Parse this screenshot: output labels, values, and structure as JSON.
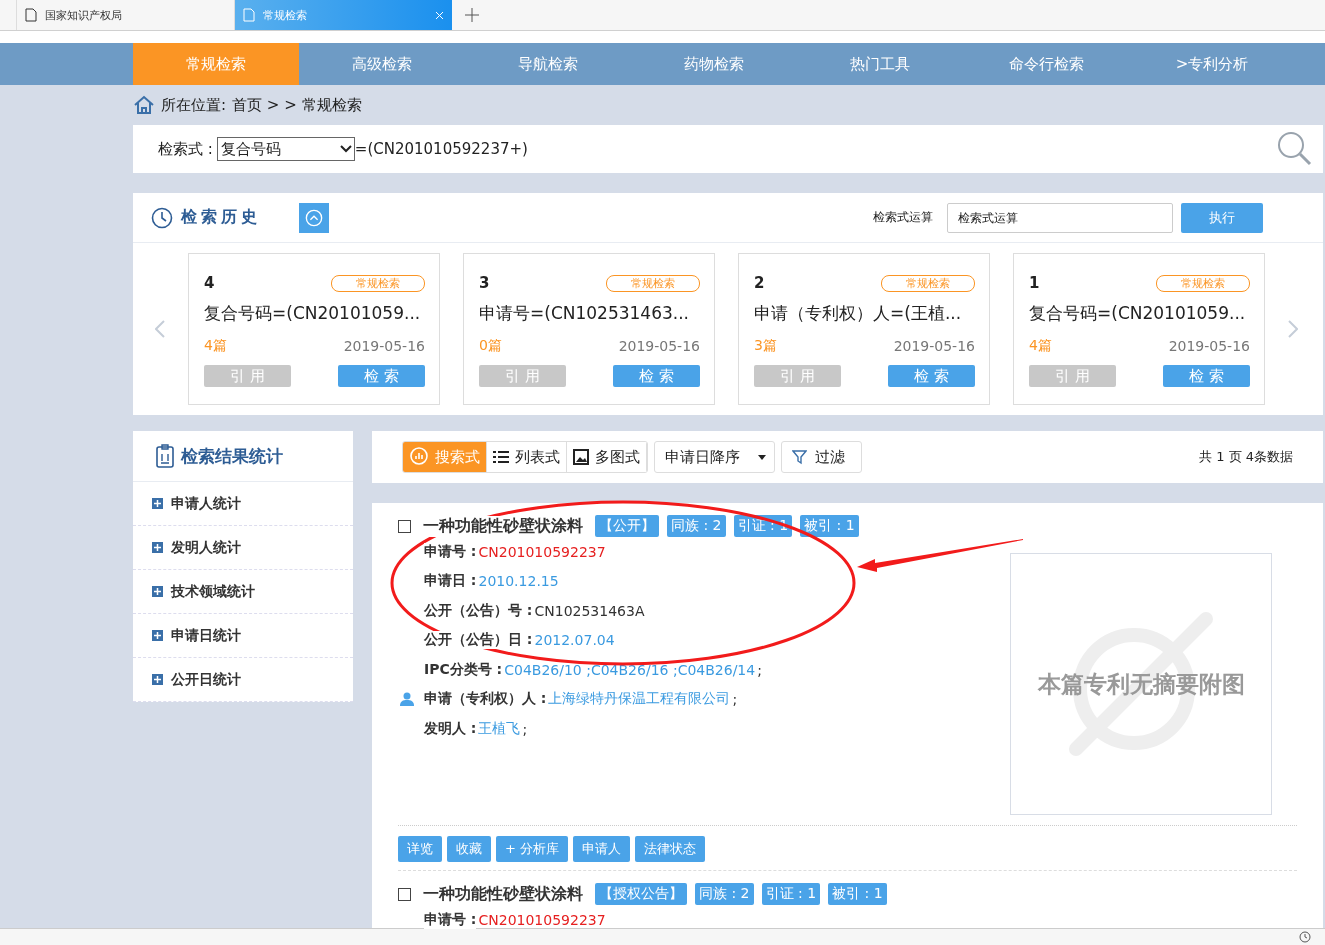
{
  "browser_tabs": [
    {
      "title": "国家知识产权局",
      "selected": false
    },
    {
      "title": "常规检索",
      "selected": true
    }
  ],
  "nav": [
    {
      "label": "常规检索",
      "selected": true
    },
    {
      "label": "高级检索",
      "selected": false
    },
    {
      "label": "导航检索",
      "selected": false
    },
    {
      "label": "药物检索",
      "selected": false
    },
    {
      "label": "热门工具",
      "selected": false
    },
    {
      "label": "命令行检索",
      "selected": false
    },
    {
      "label": ">专利分析",
      "selected": false
    }
  ],
  "breadcrumb": {
    "label": "所在位置:",
    "path": "首页 > > 常规检索"
  },
  "search": {
    "label": "检索式 :",
    "field_type": "复合号码",
    "value": "=(CN201010592237+)"
  },
  "history": {
    "title": "检索历史",
    "calc_label": "检索式运算",
    "calc_placeholder": "检索式运算",
    "run_button": "执行",
    "cards": [
      {
        "number": "4",
        "tag": "常规检索",
        "query": "复合号码=(CN20101059...",
        "count": "4篇",
        "date": "2019-05-16",
        "cite_button": "引 用",
        "search_button": "检 索"
      },
      {
        "number": "3",
        "tag": "常规检索",
        "query": "申请号=(CN102531463...",
        "count": "0篇",
        "date": "2019-05-16",
        "cite_button": "引 用",
        "search_button": "检 索"
      },
      {
        "number": "2",
        "tag": "常规检索",
        "query": "申请（专利权）人=(王植...",
        "count": "3篇",
        "date": "2019-05-16",
        "cite_button": "引 用",
        "search_button": "检 索"
      },
      {
        "number": "1",
        "tag": "常规检索",
        "query": "复合号码=(CN20101059...",
        "count": "4篇",
        "date": "2019-05-16",
        "cite_button": "引 用",
        "search_button": "检 索"
      }
    ]
  },
  "stats": {
    "title": "检索结果统计",
    "items": [
      "申请人统计",
      "发明人统计",
      "技术领域统计",
      "申请日统计",
      "公开日统计"
    ]
  },
  "toolbar": {
    "views": [
      {
        "label": "搜索式",
        "selected": true
      },
      {
        "label": "列表式",
        "selected": false
      },
      {
        "label": "多图式",
        "selected": false
      }
    ],
    "sort": "申请日降序",
    "filter": "过滤",
    "summary": "共 1 页 4条数据"
  },
  "results": [
    {
      "checked": false,
      "title": "一种功能性砂壁状涂料",
      "tags": [
        "【公开】",
        "同族 : 2",
        "引证 : 1",
        "被引 : 1"
      ],
      "fields": [
        {
          "kind": "number",
          "label": "申请号 :",
          "value": "CN201010592237"
        },
        {
          "kind": "link",
          "label": "申请日 :",
          "value": "2010.12.15"
        },
        {
          "kind": "plain",
          "label": "公开（公告）号 :",
          "value": "CN102531463A"
        },
        {
          "kind": "link",
          "label": "公开（公告）日 :",
          "value": "2012.07.04"
        },
        {
          "kind": "link",
          "label": "IPC分类号 :",
          "value": "C04B26/10 ;C04B26/16 ;C04B26/14",
          "suffix": ";"
        },
        {
          "kind": "person",
          "label": "申请（专利权）人 :",
          "value": "上海绿特丹保温工程有限公司",
          "suffix": ";"
        },
        {
          "kind": "link",
          "label": "发明人 :",
          "value": "王植飞",
          "suffix": ";"
        }
      ],
      "image_text": "本篇专利无摘要附图",
      "actions": [
        "详览",
        "收藏",
        "+ 分析库",
        "申请人",
        "法律状态"
      ]
    },
    {
      "checked": false,
      "title": "一种功能性砂壁状涂料",
      "tags": [
        "【授权公告】",
        "同族 : 2",
        "引证 : 1",
        "被引 : 1"
      ],
      "fields": [
        {
          "kind": "number",
          "label": "申请号 :",
          "value": "CN201010592237"
        }
      ]
    }
  ]
}
